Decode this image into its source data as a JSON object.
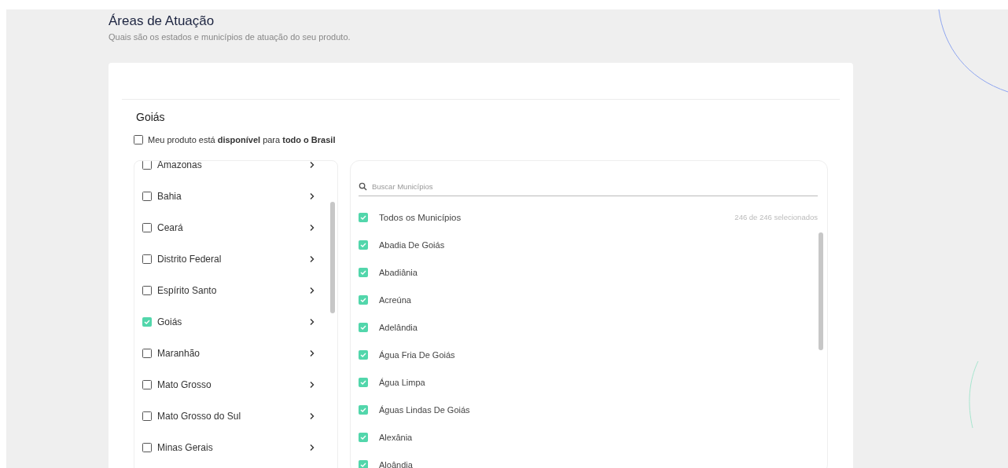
{
  "page": {
    "title": "Áreas de Atuação",
    "subtitle": "Quais são os estados e municípios de atuação do seu produto."
  },
  "section_title": "Goiás",
  "whole_country": {
    "label": "Meu produto está **disponível** para **todo o Brasil**",
    "checked": false
  },
  "states": [
    {
      "name": "Amazonas",
      "checked": false
    },
    {
      "name": "Bahia",
      "checked": false
    },
    {
      "name": "Ceará",
      "checked": false
    },
    {
      "name": "Distrito Federal",
      "checked": false
    },
    {
      "name": "Espírito Santo",
      "checked": false
    },
    {
      "name": "Goiás",
      "checked": true
    },
    {
      "name": "Maranhão",
      "checked": false
    },
    {
      "name": "Mato Grosso",
      "checked": false
    },
    {
      "name": "Mato Grosso do Sul",
      "checked": false
    },
    {
      "name": "Minas Gerais",
      "checked": false
    }
  ],
  "municipalities": {
    "placeholder": "Buscar Municípios",
    "all": {
      "label": "Todos os Municípios",
      "checked": true,
      "count": "246 de 246 selecionados"
    },
    "items": [
      {
        "name": "Abadia De Goiás",
        "checked": true
      },
      {
        "name": "Abadiânia",
        "checked": true
      },
      {
        "name": "Acreúna",
        "checked": true
      },
      {
        "name": "Adelândia",
        "checked": true
      },
      {
        "name": "Água Fria De Goiás",
        "checked": true
      },
      {
        "name": "Água Limpa",
        "checked": true
      },
      {
        "name": "Águas Lindas De Goiás",
        "checked": true
      },
      {
        "name": "Alexânia",
        "checked": true
      },
      {
        "name": "Aloândia",
        "checked": true
      }
    ]
  }
}
